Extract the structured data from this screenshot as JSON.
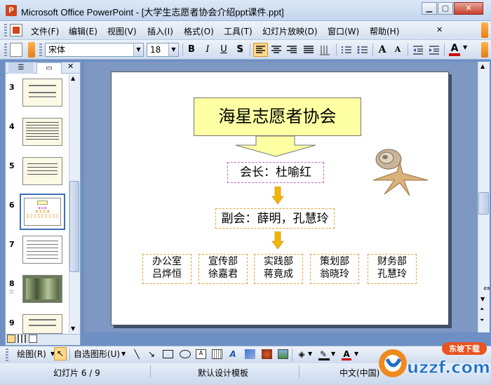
{
  "window": {
    "title": "Microsoft Office PowerPoint - [大学生志愿者协会介绍ppt课件.ppt]",
    "app_icon": "P"
  },
  "menu": [
    {
      "label": "文件(F)"
    },
    {
      "label": "编辑(E)"
    },
    {
      "label": "视图(V)"
    },
    {
      "label": "插入(I)"
    },
    {
      "label": "格式(O)"
    },
    {
      "label": "工具(T)"
    },
    {
      "label": "幻灯片放映(D)"
    },
    {
      "label": "窗口(W)"
    },
    {
      "label": "帮助(H)"
    }
  ],
  "toolbar": {
    "font_name": "宋体",
    "font_size": "18",
    "bold": "B",
    "italic": "I",
    "underline": "U",
    "shadow": "S",
    "grow": "A",
    "shrink": "A",
    "font_color": "A"
  },
  "slides": [
    {
      "num": "3"
    },
    {
      "num": "4"
    },
    {
      "num": "5"
    },
    {
      "num": "6"
    },
    {
      "num": "7"
    },
    {
      "num": "8"
    },
    {
      "num": "9"
    }
  ],
  "slide": {
    "title": "海星志愿者协会",
    "president": "会长：杜喻红",
    "vice": "副会：薛明，孔慧玲",
    "departments": [
      {
        "name": "办公室",
        "person": "吕烨恒"
      },
      {
        "name": "宣传部",
        "person": "徐嘉君"
      },
      {
        "name": "实践部",
        "person": "蒋竟成"
      },
      {
        "name": "策划部",
        "person": "翁晓玲"
      },
      {
        "name": "财务部",
        "person": "孔慧玲"
      }
    ]
  },
  "drawbar": {
    "draw_label": "绘图(R)",
    "autoshapes_label": "自选图形(U)"
  },
  "status": {
    "slide_pos": "幻灯片 6 / 9",
    "template": "默认设计模板",
    "language": "中文(中国)"
  },
  "watermark": {
    "text": "uzzf.com",
    "subtitle": "东坡下载"
  },
  "colors": {
    "title_fill": "#ffffa3",
    "arrow": "#f0b800",
    "accent_border": "#e8a23c"
  }
}
